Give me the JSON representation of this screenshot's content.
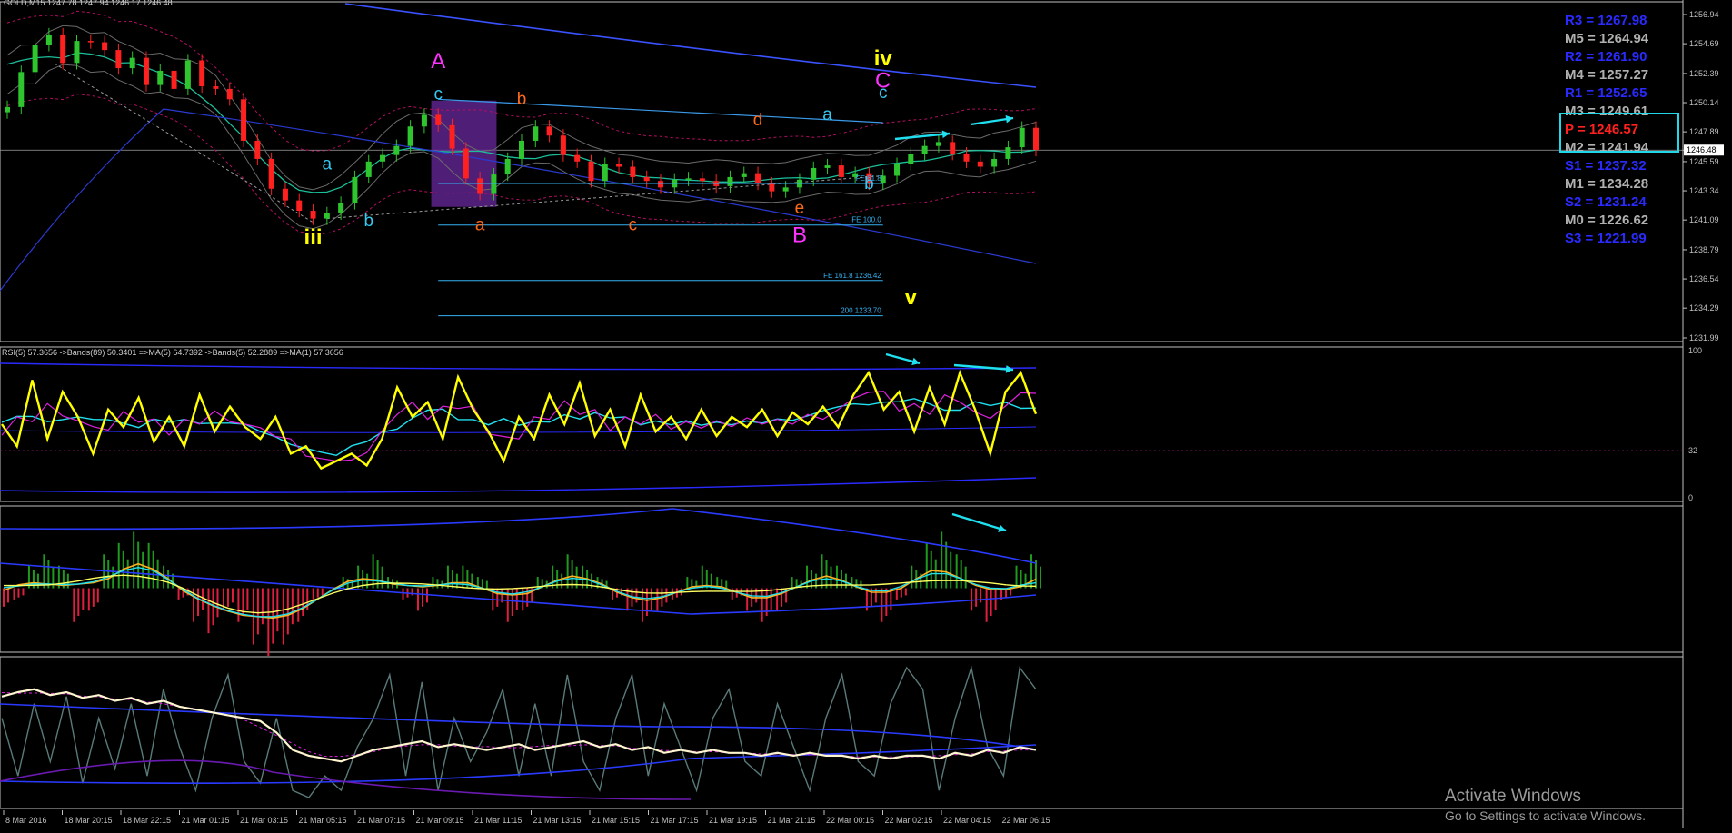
{
  "window": {
    "title": "GOLD,M15  1247.78 1247.94 1246.17 1246.48"
  },
  "chart_data": [
    {
      "type": "line",
      "pane": "price",
      "symbol": "GOLD,M15",
      "ohlc_label": "GOLD,M15  1247.78 1247.94 1246.17 1246.48",
      "ylim": [
        1231.99,
        1257.5
      ],
      "y_ticks": [
        "1256.94",
        "1254.69",
        "1252.39",
        "1250.14",
        "1247.89",
        "1246.48",
        "1245.59",
        "1243.34",
        "1241.09",
        "1238.79",
        "1236.54",
        "1234.29",
        "1231.99"
      ],
      "current_price": "1246.48",
      "close_series": [
        1249.8,
        1252.5,
        1254.6,
        1255.4,
        1253.2,
        1254.9,
        1254.8,
        1254.2,
        1252.8,
        1253.6,
        1251.5,
        1252.6,
        1251.2,
        1253.4,
        1251.4,
        1251.2,
        1250.4,
        1247.2,
        1245.8,
        1243.5,
        1242.6,
        1241.8,
        1241.2,
        1241.6,
        1242.4,
        1244.4,
        1245.6,
        1246.1,
        1246.8,
        1248.3,
        1249.2,
        1248.4,
        1246.6,
        1244.3,
        1243.1,
        1244.6,
        1245.8,
        1247.2,
        1248.3,
        1247.6,
        1246.1,
        1245.6,
        1244.1,
        1245.4,
        1245.2,
        1244.4,
        1244.1,
        1243.6,
        1244.2,
        1244.3,
        1244.1,
        1243.7,
        1244.4,
        1244.7,
        1243.9,
        1243.3,
        1243.6,
        1244.2,
        1245.1,
        1245.3,
        1244.4,
        1244.7,
        1243.9,
        1244.5,
        1245.4,
        1246.2,
        1246.8,
        1247.1,
        1246.2,
        1245.6,
        1245.2,
        1245.8,
        1246.7,
        1248.2,
        1246.5
      ],
      "levels": [
        {
          "label": "FE 61.8",
          "value": 1243.9
        },
        {
          "label": "FE 100.0",
          "value": 1240.7
        },
        {
          "label": "FE 161.8 1236.42",
          "value": 1236.42
        },
        {
          "label": "200 1233.70",
          "value": 1233.7
        }
      ],
      "wave_labels": [
        {
          "text": "iii",
          "color": "#ffff00",
          "i": 22,
          "price": 1239.2
        },
        {
          "text": "a",
          "color": "#35c8f0",
          "i": 23,
          "price": 1245.0
        },
        {
          "text": "b",
          "color": "#35c8f0",
          "i": 26,
          "price": 1240.6
        },
        {
          "text": "A",
          "color": "#ff33ff",
          "i": 31,
          "price": 1252.8
        },
        {
          "text": "c",
          "color": "#35c8f0",
          "i": 31,
          "price": 1250.4
        },
        {
          "text": "a",
          "color": "#ff6a1a",
          "i": 34,
          "price": 1240.3
        },
        {
          "text": "b",
          "color": "#ff6a1a",
          "i": 37,
          "price": 1250.0
        },
        {
          "text": "c",
          "color": "#ff6a1a",
          "i": 45,
          "price": 1240.3
        },
        {
          "text": "d",
          "color": "#ff6a1a",
          "i": 54,
          "price": 1248.4
        },
        {
          "text": "e",
          "color": "#ff6a1a",
          "i": 57,
          "price": 1241.6
        },
        {
          "text": "B",
          "color": "#ff33ff",
          "i": 57,
          "price": 1239.4
        },
        {
          "text": "a",
          "color": "#35c8f0",
          "i": 59,
          "price": 1248.8
        },
        {
          "text": "b",
          "color": "#35c8f0",
          "i": 62,
          "price": 1243.5
        },
        {
          "text": "iv",
          "color": "#ffff00",
          "i": 63,
          "price": 1253.0
        },
        {
          "text": "C",
          "color": "#ff33ff",
          "i": 63,
          "price": 1251.3
        },
        {
          "text": "c",
          "color": "#35c8f0",
          "i": 63,
          "price": 1250.5
        },
        {
          "text": "v",
          "color": "#ffff00",
          "i": 65,
          "price": 1234.6
        }
      ]
    },
    {
      "type": "line",
      "pane": "rsi",
      "legend": "RSI(5) 57.3656 ->Bands(89) 50.3401 =>MA(5) 64.7392 ->Bands(5) 52.2889 =>MA(1) 57.3656",
      "ylim": [
        0,
        100
      ],
      "y_ticks": [
        "100",
        "32",
        "0"
      ],
      "level": 32,
      "series": [
        {
          "name": "RSI(5)",
          "values": [
            50,
            35,
            80,
            40,
            72,
            55,
            30,
            60,
            48,
            68,
            38,
            55,
            35,
            70,
            45,
            62,
            48,
            40,
            55,
            30,
            35,
            20,
            25,
            30,
            22,
            40,
            75,
            55,
            65,
            40,
            82,
            60,
            45,
            25,
            55,
            40,
            70,
            50,
            78,
            42,
            60,
            35,
            70,
            45,
            55,
            40,
            60,
            42,
            55,
            48,
            60,
            42,
            58,
            50,
            62,
            48,
            70,
            85,
            60,
            72,
            45,
            75,
            50,
            85,
            60,
            30,
            72,
            85,
            57
          ]
        }
      ]
    },
    {
      "type": "bar",
      "pane": "histogram",
      "ylim": [
        -6,
        6
      ],
      "values": [
        -2,
        -1,
        2,
        3,
        2,
        -3,
        -2,
        3,
        4,
        5,
        4,
        2,
        -1,
        -3,
        -4,
        -2,
        -3,
        -5,
        -6,
        -5,
        -3,
        -1,
        0,
        1,
        2,
        3,
        1,
        -1,
        -2,
        1,
        2,
        2,
        1,
        -2,
        -3,
        -2,
        1,
        2,
        3,
        2,
        1,
        -1,
        -2,
        -3,
        -2,
        -1,
        1,
        2,
        1,
        -1,
        -2,
        -3,
        -2,
        1,
        2,
        3,
        2,
        1,
        -2,
        -3,
        -1,
        2,
        4,
        5,
        3,
        -2,
        -3,
        -1,
        2,
        3
      ]
    },
    {
      "type": "line",
      "pane": "stochastic",
      "ylim": [
        0,
        100
      ],
      "series": [
        {
          "name": "main",
          "values": [
            75,
            78,
            80,
            76,
            78,
            74,
            76,
            72,
            74,
            70,
            72,
            68,
            66,
            64,
            62,
            60,
            58,
            50,
            38,
            34,
            32,
            30,
            34,
            38,
            40,
            42,
            44,
            40,
            42,
            40,
            38,
            40,
            42,
            38,
            40,
            42,
            44,
            40,
            42,
            38,
            40,
            36,
            38,
            36,
            38,
            36,
            36,
            34,
            36,
            34,
            36,
            34,
            34,
            32,
            34,
            32,
            34,
            34,
            32,
            36,
            34,
            38,
            36,
            40,
            38
          ]
        },
        {
          "name": "fast",
          "values": [
            60,
            20,
            70,
            30,
            75,
            15,
            60,
            25,
            70,
            20,
            80,
            40,
            10,
            60,
            90,
            30,
            15,
            60,
            10,
            5,
            20,
            10,
            40,
            60,
            90,
            20,
            85,
            10,
            60,
            30,
            50,
            80,
            20,
            70,
            20,
            90,
            30,
            10,
            60,
            90,
            20,
            70,
            40,
            10,
            60,
            80,
            30,
            20,
            70,
            40,
            10,
            60,
            90,
            30,
            20,
            70,
            95,
            80,
            10,
            60,
            95,
            40,
            20,
            95,
            80
          ]
        }
      ]
    }
  ],
  "pivots": [
    {
      "text": "R3 = 1267.98",
      "color": "#2a2aff"
    },
    {
      "text": "M5 = 1264.94",
      "color": "#b0b0b0"
    },
    {
      "text": "R2 = 1261.90",
      "color": "#2a2aff"
    },
    {
      "text": "M4 = 1257.27",
      "color": "#b0b0b0"
    },
    {
      "text": "R1 = 1252.65",
      "color": "#2a2aff"
    },
    {
      "text": "M3 = 1249.61",
      "color": "#b0b0b0"
    },
    {
      "text": "P  = 1246.57",
      "color": "#ff2020"
    },
    {
      "text": "M2 = 1241.94",
      "color": "#b0b0b0"
    },
    {
      "text": "S1 = 1237.32",
      "color": "#2a2aff"
    },
    {
      "text": "M1 = 1234.28",
      "color": "#b0b0b0"
    },
    {
      "text": "S2 = 1231.24",
      "color": "#2a2aff"
    },
    {
      "text": "M0 = 1226.62",
      "color": "#b0b0b0"
    },
    {
      "text": "S3 = 1221.99",
      "color": "#2a2aff"
    }
  ],
  "time_axis": [
    "8 Mar 2016",
    "18 Mar 20:15",
    "18 Mar 22:15",
    "21 Mar 01:15",
    "21 Mar 03:15",
    "21 Mar 05:15",
    "21 Mar 07:15",
    "21 Mar 09:15",
    "21 Mar 11:15",
    "21 Mar 13:15",
    "21 Mar 15:15",
    "21 Mar 17:15",
    "21 Mar 19:15",
    "21 Mar 21:15",
    "22 Mar 00:15",
    "22 Mar 02:15",
    "22 Mar 04:15",
    "22 Mar 06:15"
  ],
  "watermark": {
    "line1": "Activate Windows",
    "line2": "Go to Settings to activate Windows."
  },
  "colors": {
    "bull": "#2ec52e",
    "bear": "#ff2020",
    "axis": "#c0c0c0",
    "rsi": "#ffff00",
    "cyan": "#20e0f0",
    "magenta": "#e020e0",
    "blue": "#2a2aff",
    "hist_up": "#1f9a1f",
    "hist_down": "#e01f3f"
  }
}
